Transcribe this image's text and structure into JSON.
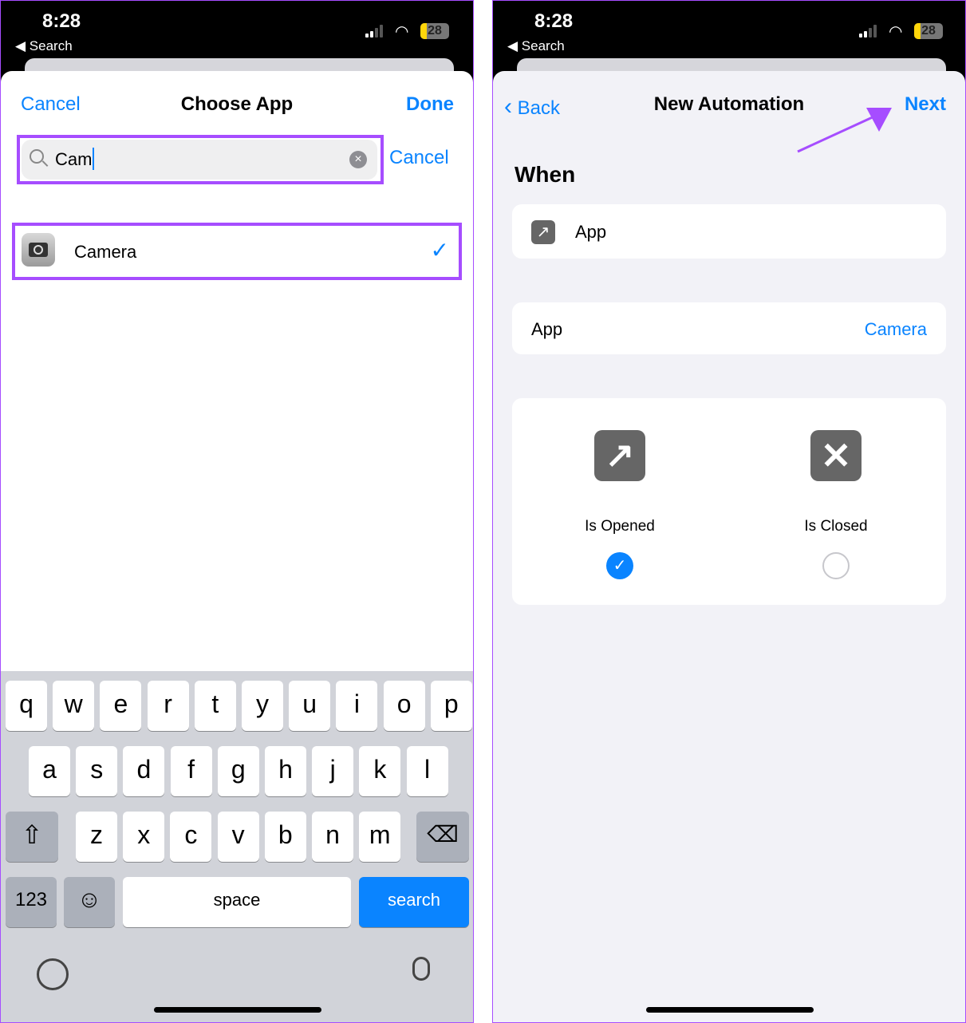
{
  "status": {
    "time": "8:28",
    "back_label": "Search",
    "battery": "28"
  },
  "left": {
    "nav": {
      "cancel": "Cancel",
      "title": "Choose App",
      "done": "Done"
    },
    "search": {
      "value": "Cam",
      "cancel": "Cancel"
    },
    "results": [
      {
        "name": "Camera",
        "selected": true
      }
    ],
    "keyboard": {
      "row1": [
        "q",
        "w",
        "e",
        "r",
        "t",
        "y",
        "u",
        "i",
        "o",
        "p"
      ],
      "row2": [
        "a",
        "s",
        "d",
        "f",
        "g",
        "h",
        "j",
        "k",
        "l"
      ],
      "row3": [
        "z",
        "x",
        "c",
        "v",
        "b",
        "n",
        "m"
      ],
      "numbers": "123",
      "space": "space",
      "search": "search"
    }
  },
  "right": {
    "nav": {
      "back": "Back",
      "title": "New Automation",
      "next": "Next"
    },
    "section": "When",
    "trigger": "App",
    "app_row": {
      "label": "App",
      "value": "Camera"
    },
    "options": [
      {
        "label": "Is Opened",
        "selected": true
      },
      {
        "label": "Is Closed",
        "selected": false
      }
    ]
  },
  "colors": {
    "accent": "#0a84ff",
    "highlight": "#a64dff"
  }
}
